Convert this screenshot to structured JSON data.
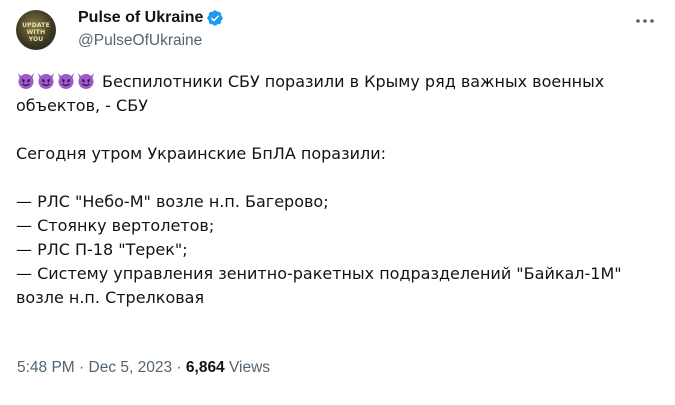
{
  "author": {
    "display_name": "Pulse of Ukraine",
    "handle": "@PulseOfUkraine",
    "avatar_text": "UPDATE WITH YOU"
  },
  "tweet": {
    "emoji": [
      "smiling-imp",
      "smiling-imp",
      "smiling-imp",
      "smiling-imp"
    ],
    "headline_part1": "Беспилотники СБУ поразили в Крыму ряд важных военных",
    "headline_part2": "объектов, - СБУ",
    "intro": "Сегодня утром Украинские БпЛА поразили:",
    "list_items": [
      "— РЛС \"Небо-М\" возле н.п. Багерово;",
      "— Стоянку вертолетов;",
      "— РЛС П-18 \"Терек\";",
      "— Систему управления зенитно-ракетных подразделений \"Байкал-1М\""
    ],
    "list_continuation": "возле н.п. Стрелковая"
  },
  "meta": {
    "time": "5:48 PM",
    "separator1": " · ",
    "date": "Dec 5, 2023",
    "separator2": " · ",
    "views_count": "6,864",
    "views_label": " Views"
  },
  "colors": {
    "verified_badge": "#1d9bf0",
    "secondary_text": "#536471",
    "devil_emoji": "#9b59c9"
  }
}
